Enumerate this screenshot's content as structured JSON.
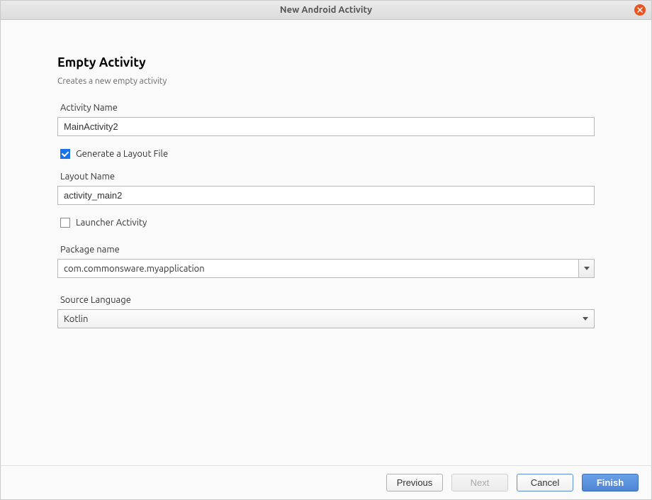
{
  "window": {
    "title": "New Android Activity"
  },
  "header": {
    "title": "Empty Activity",
    "subtitle": "Creates a new empty activity"
  },
  "form": {
    "activityName": {
      "label": "Activity Name",
      "value": "MainActivity2"
    },
    "generateLayout": {
      "label": "Generate a Layout File",
      "checked": true
    },
    "layoutName": {
      "label": "Layout Name",
      "value": "activity_main2"
    },
    "launcherActivity": {
      "label": "Launcher Activity",
      "checked": false
    },
    "packageName": {
      "label": "Package name",
      "value": "com.commonsware.myapplication"
    },
    "sourceLanguage": {
      "label": "Source Language",
      "value": "Kotlin"
    }
  },
  "footer": {
    "previous": "Previous",
    "next": "Next",
    "cancel": "Cancel",
    "finish": "Finish"
  }
}
